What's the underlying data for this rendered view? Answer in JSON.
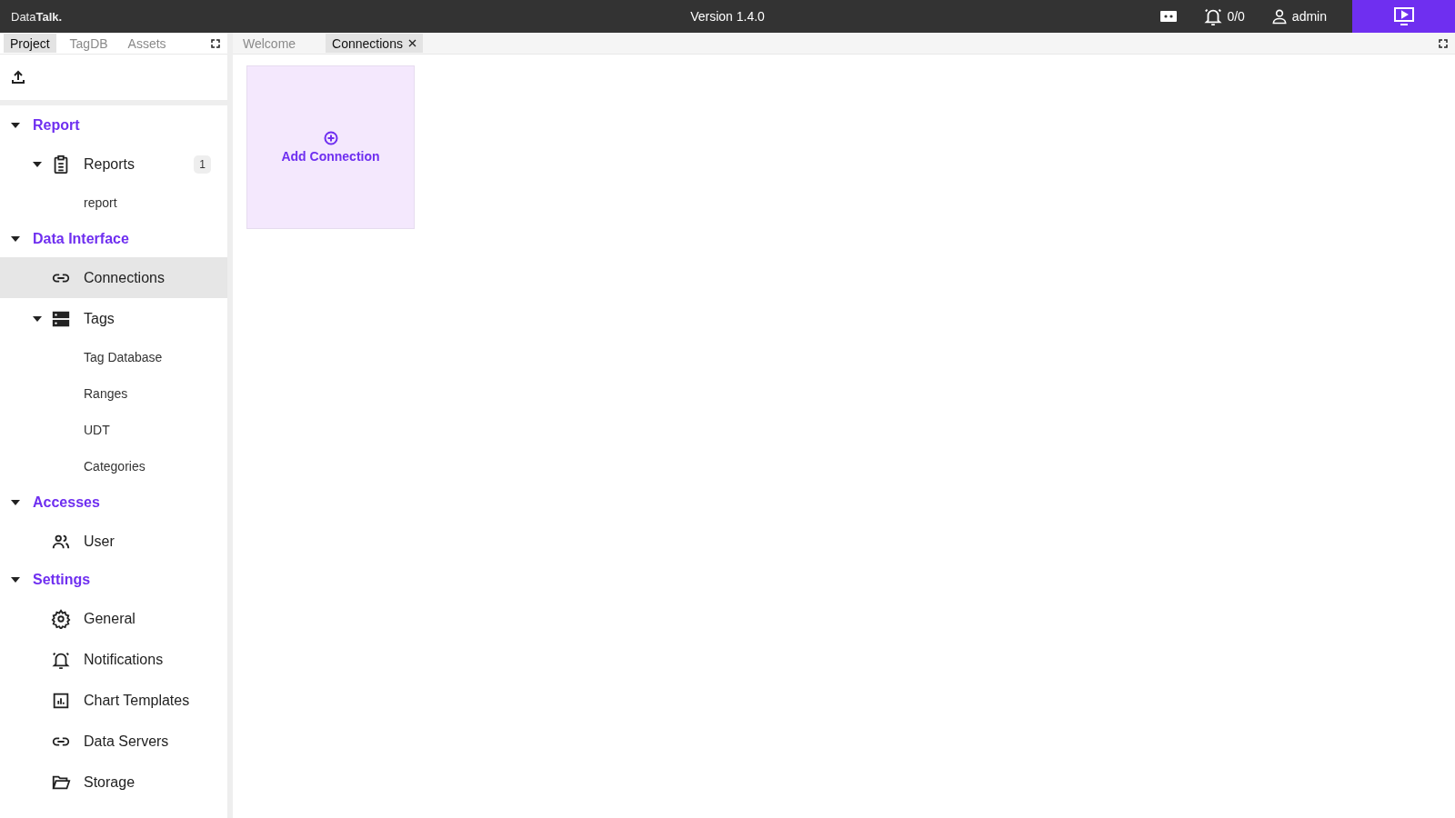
{
  "header": {
    "logo": "Data**Talk.**",
    "version": "Version 1.4.0",
    "alarms": "0/0",
    "user": "admin"
  },
  "sidebar": {
    "tabs": [
      {
        "label": "Project",
        "selected": true
      },
      {
        "label": "TagDB",
        "selected": false
      },
      {
        "label": "Assets",
        "selected": false
      }
    ],
    "sections": [
      {
        "title": "Report",
        "expanded": true,
        "items": [
          {
            "label": "Reports",
            "badge": "1",
            "expanded": true,
            "selected": false,
            "children": [
              {
                "label": "report"
              }
            ]
          }
        ]
      },
      {
        "title": "Data Interface",
        "expanded": true,
        "items": [
          {
            "label": "Connections",
            "selected": true
          },
          {
            "label": "Tags",
            "expanded": true,
            "selected": false,
            "children": [
              {
                "label": "Tag Database"
              },
              {
                "label": "Ranges"
              },
              {
                "label": "UDT"
              },
              {
                "label": "Categories"
              }
            ]
          }
        ]
      },
      {
        "title": "Accesses",
        "expanded": true,
        "items": [
          {
            "label": "User",
            "selected": false
          }
        ]
      },
      {
        "title": "Settings",
        "expanded": true,
        "items": [
          {
            "label": "General",
            "selected": false
          },
          {
            "label": "Notifications",
            "selected": false
          },
          {
            "label": "Chart Templates",
            "selected": false
          },
          {
            "label": "Data Servers",
            "selected": false
          },
          {
            "label": "Storage",
            "selected": false
          }
        ]
      }
    ]
  },
  "editor": {
    "tabs": [
      {
        "label": "Welcome",
        "selected": false,
        "closable": false
      },
      {
        "label": "Connections",
        "selected": true,
        "closable": true
      }
    ],
    "cards": [
      {
        "label": "Add Connection"
      }
    ]
  }
}
